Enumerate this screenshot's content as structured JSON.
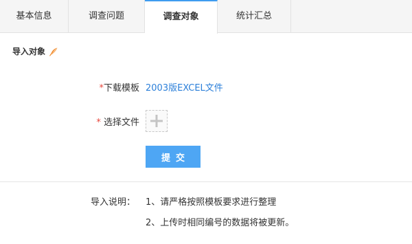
{
  "tabs": [
    {
      "label": "基本信息",
      "active": false
    },
    {
      "label": "调查问题",
      "active": false
    },
    {
      "label": "调查对象",
      "active": true
    },
    {
      "label": "统计汇总",
      "active": false
    }
  ],
  "section": {
    "title": "导入对象",
    "icon": "quill-icon"
  },
  "form": {
    "required_mark": "*",
    "template_label": "下载模板",
    "template_link": "2003版EXCEL文件",
    "file_label": "选择文件",
    "upload_icon": "plus-icon",
    "submit_label": "提交"
  },
  "notes": {
    "label": "导入说明：",
    "items": [
      "1、请严格按照模板要求进行整理",
      "2、上传时相同编号的数据将被更新。"
    ]
  },
  "colors": {
    "accent": "#4ea6f4",
    "link": "#2b7fd9",
    "required": "#e8463c",
    "tab_indicator": "#3f9cf0",
    "quill": "#f08a2c"
  }
}
